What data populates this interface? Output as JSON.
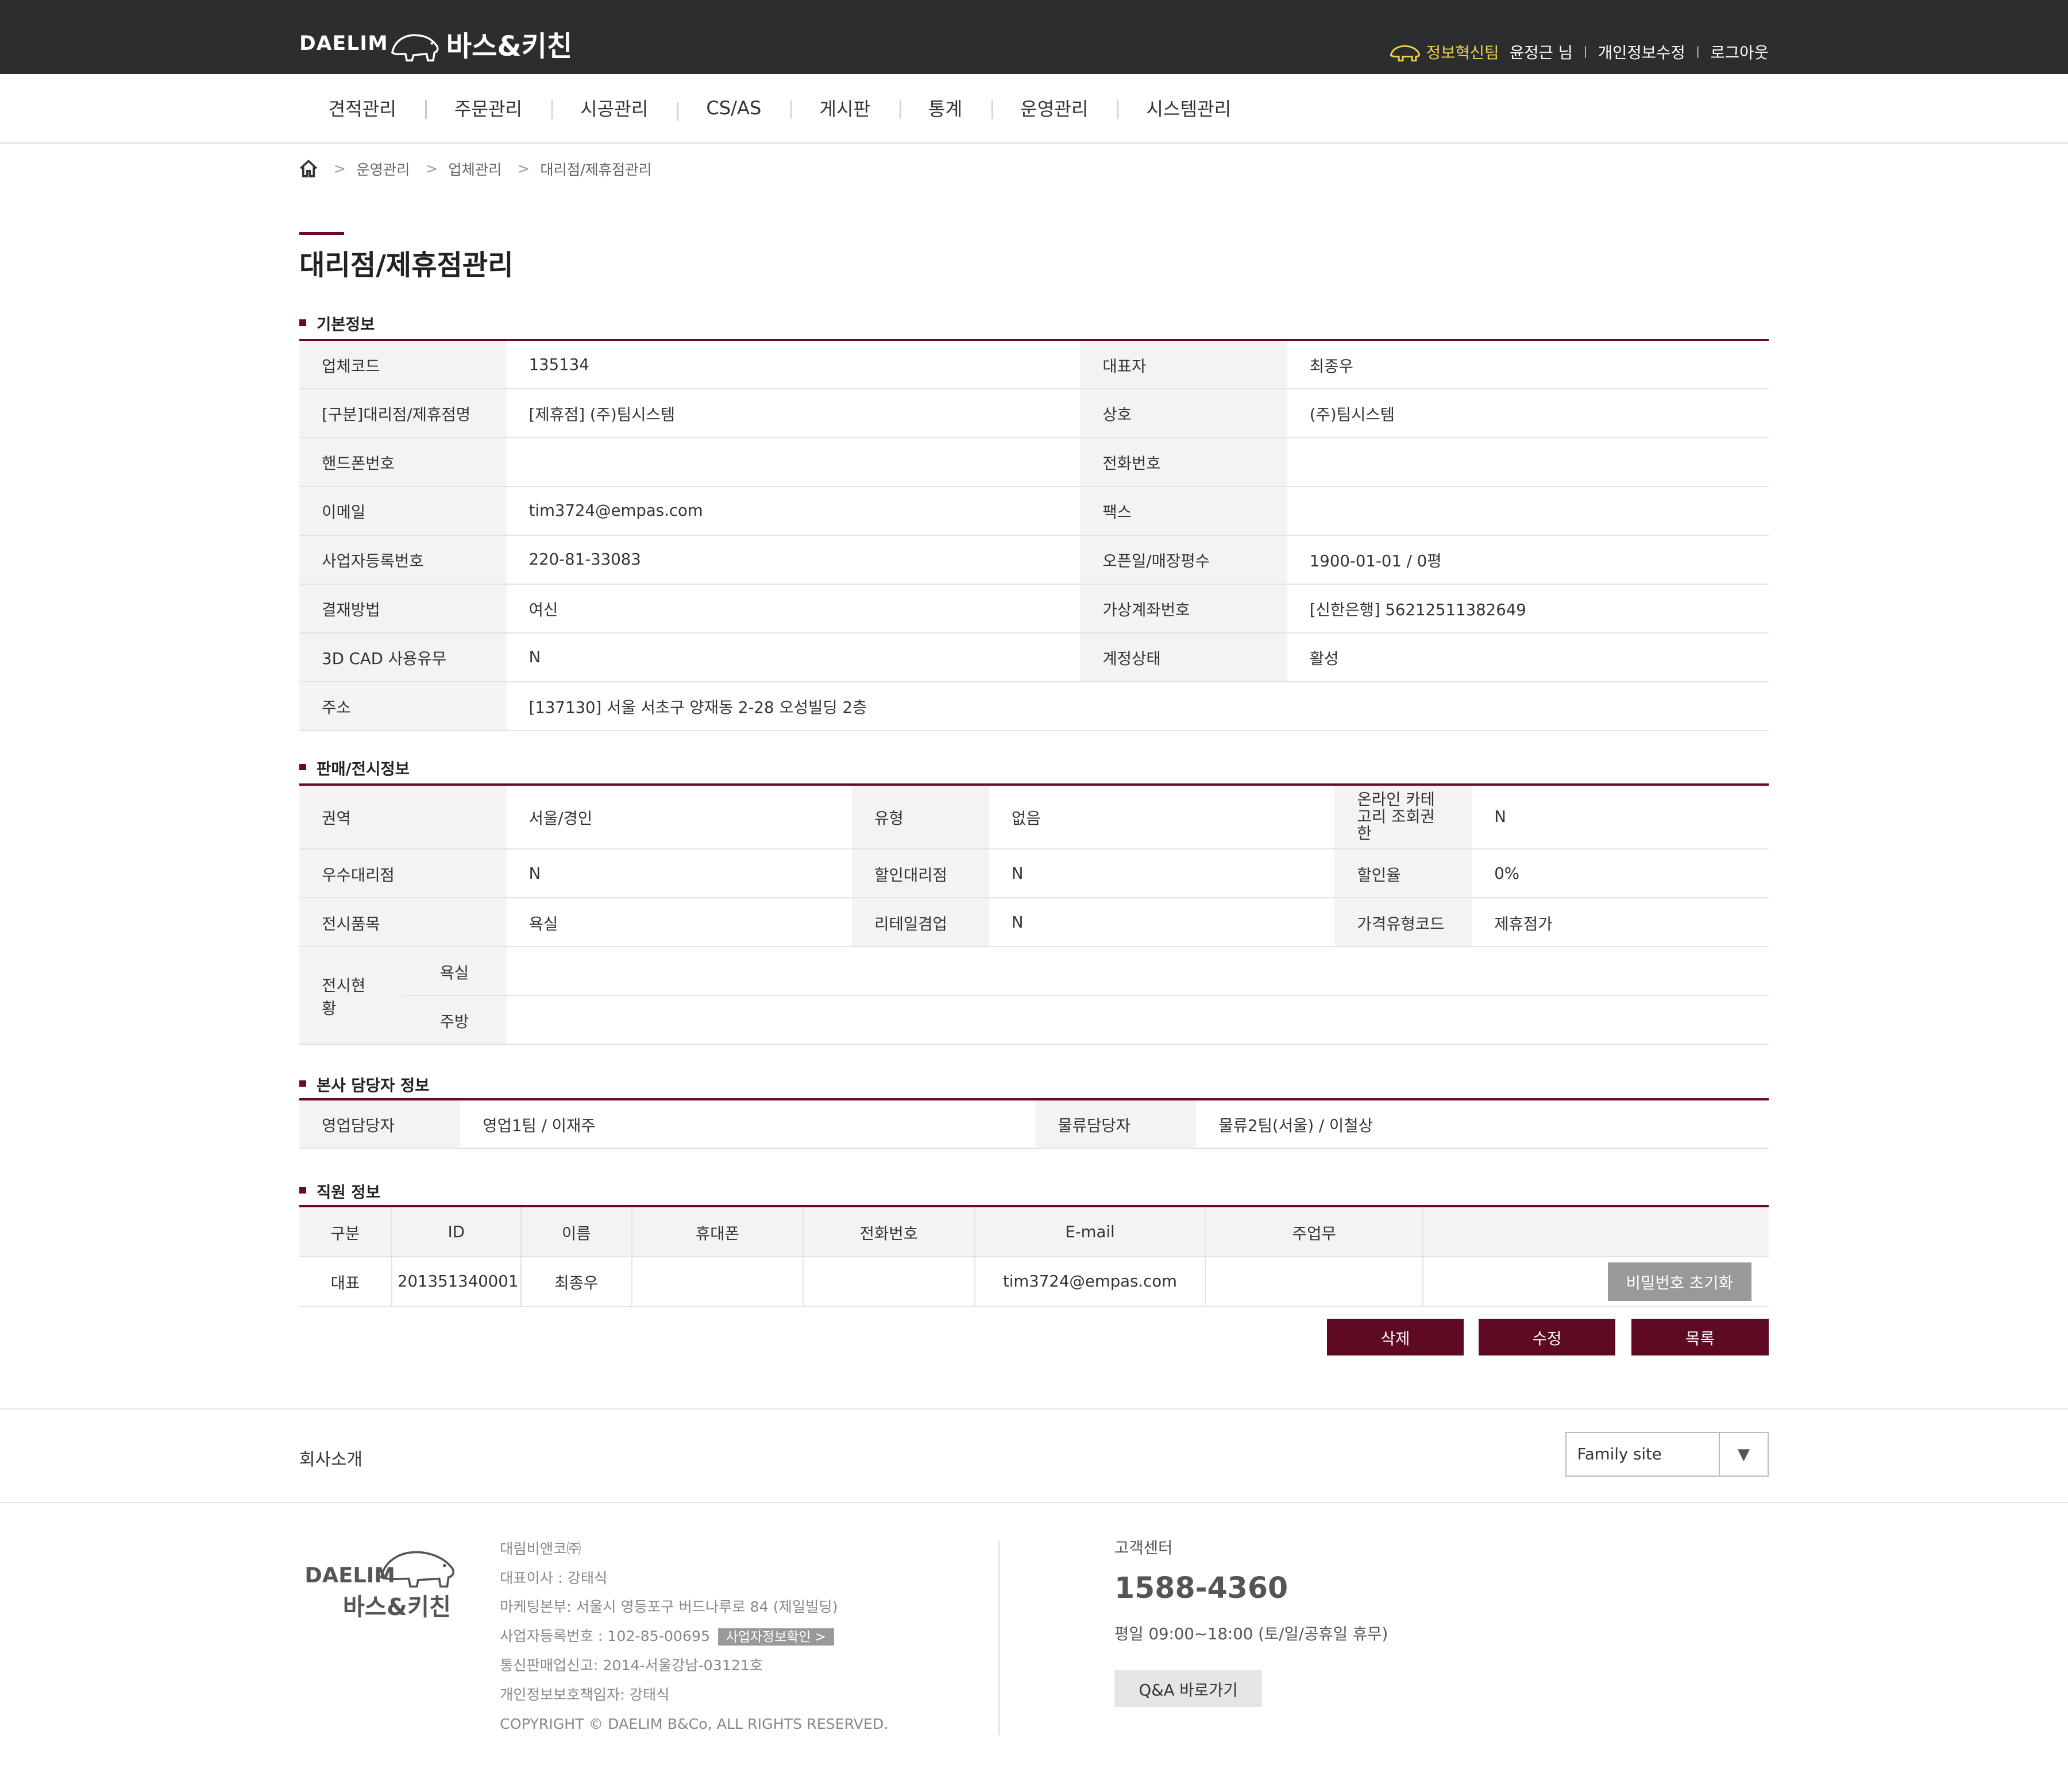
{
  "header": {
    "logo_daelim": "DAELIM",
    "logo_bath": "바스&키친",
    "team": "정보혁신팀",
    "user_name": "윤정근 님",
    "edit_profile": "개인정보수정",
    "logout": "로그아웃"
  },
  "gnb": [
    "견적관리",
    "주문관리",
    "시공관리",
    "CS/AS",
    "게시판",
    "통계",
    "운영관리",
    "시스템관리"
  ],
  "breadcrumb": [
    "운영관리",
    "업체관리",
    "대리점/제휴점관리"
  ],
  "page_title": "대리점/제휴점관리",
  "basic": {
    "heading": "기본정보",
    "rows": [
      [
        "업체코드",
        "135134",
        "대표자",
        "최종우"
      ],
      [
        "[구분]대리점/제휴점명",
        "[제휴점] (주)팀시스템",
        "상호",
        "(주)팀시스템"
      ],
      [
        "핸드폰번호",
        "",
        "전화번호",
        ""
      ],
      [
        "이메일",
        "tim3724@empas.com",
        "팩스",
        ""
      ],
      [
        "사업자등록번호",
        "220-81-33083",
        "오픈일/매장평수",
        "1900-01-01 / 0평"
      ],
      [
        "결재방법",
        "여신",
        "가상계좌번호",
        "[신한은행] 56212511382649"
      ],
      [
        "3D CAD 사용유무",
        "N",
        "계정상태",
        "활성"
      ]
    ],
    "address_label": "주소",
    "address": "[137130] 서울 서초구 양재동 2-28 오성빌딩 2층"
  },
  "sales": {
    "heading": "판매/전시정보",
    "rows": [
      [
        "권역",
        "서울/경인",
        "유형",
        "없음",
        "온라인 카테고리 조회권한",
        "N"
      ],
      [
        "우수대리점",
        "N",
        "할인대리점",
        "N",
        "할인율",
        "0%"
      ],
      [
        "전시품목",
        "욕실",
        "리테일겸업",
        "N",
        "가격유형코드",
        "제휴점가"
      ]
    ],
    "display_label": "전시현황",
    "display_bath": "욕실",
    "display_kitchen": "주방"
  },
  "hq": {
    "heading": "본사 담당자 정보",
    "sales_label": "영업담당자",
    "sales_value": "영업1팀 / 이재주",
    "logistics_label": "물류담당자",
    "logistics_value": "물류2팀(서울) / 이철상"
  },
  "staff": {
    "heading": "직원 정보",
    "columns": [
      "구분",
      "ID",
      "이름",
      "휴대폰",
      "전화번호",
      "E-mail",
      "주업무",
      ""
    ],
    "rows": [
      [
        "대표",
        "201351340001",
        "최종우",
        "",
        "",
        "tim3724@empas.com",
        ""
      ]
    ],
    "reset_pw": "비밀번호 초기화"
  },
  "actions": {
    "delete": "삭제",
    "edit": "수정",
    "list": "목록"
  },
  "footer": {
    "about": "회사소개",
    "family_site": "Family site",
    "company": "대림비앤코㈜",
    "ceo": "대표이사 : 강태식",
    "hq_address": "마케팅본부: 서울시 영등포구 버드나루로 84 (제일빌딩)",
    "biz_no": "사업자등록번호 : 102-85-00695",
    "biz_check": "사업자정보확인 >",
    "mail_order": "통신판매업신고: 2014-서울강남-03121호",
    "privacy": "개인정보보호책임자: 강태식",
    "copyright": "COPYRIGHT © DAELIM B&Co, ALL RIGHTS RESERVED.",
    "cs_label": "고객센터",
    "cs_tel": "1588-4360",
    "cs_hours": "평일 09:00~18:00 (토/일/공휴일 휴무)",
    "qa_button": "Q&A 바로가기"
  },
  "colors": {
    "accent": "#6b0a22",
    "header_bg": "#2b2d2f",
    "label_bg": "#f5f2f3"
  }
}
